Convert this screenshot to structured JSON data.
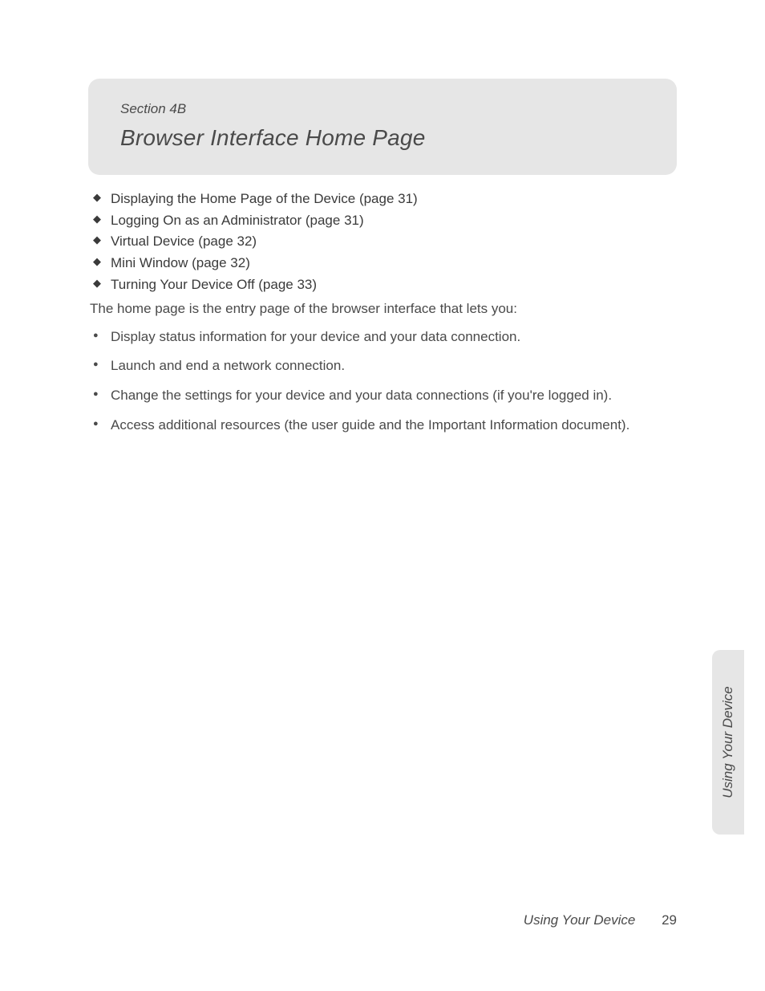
{
  "header": {
    "section_label": "Section 4B",
    "title": "Browser Interface Home Page"
  },
  "toc": [
    "Displaying the Home Page of the Device (page 31)",
    "Logging On as an Administrator (page 31)",
    "Virtual Device (page 32)",
    "Mini Window (page 32)",
    "Turning Your Device Off (page 33)"
  ],
  "intro": "The home page is the entry page of the browser interface that lets you:",
  "bullets": [
    "Display status information for your device and your data connection.",
    "Launch and end a network connection.",
    "Change the settings for your device and your data connections (if you're logged in).",
    "Access additional resources (the user guide and the Important Information document)."
  ],
  "side_tab": "Using Your Device",
  "footer": {
    "label": "Using Your Device",
    "page": "29"
  }
}
